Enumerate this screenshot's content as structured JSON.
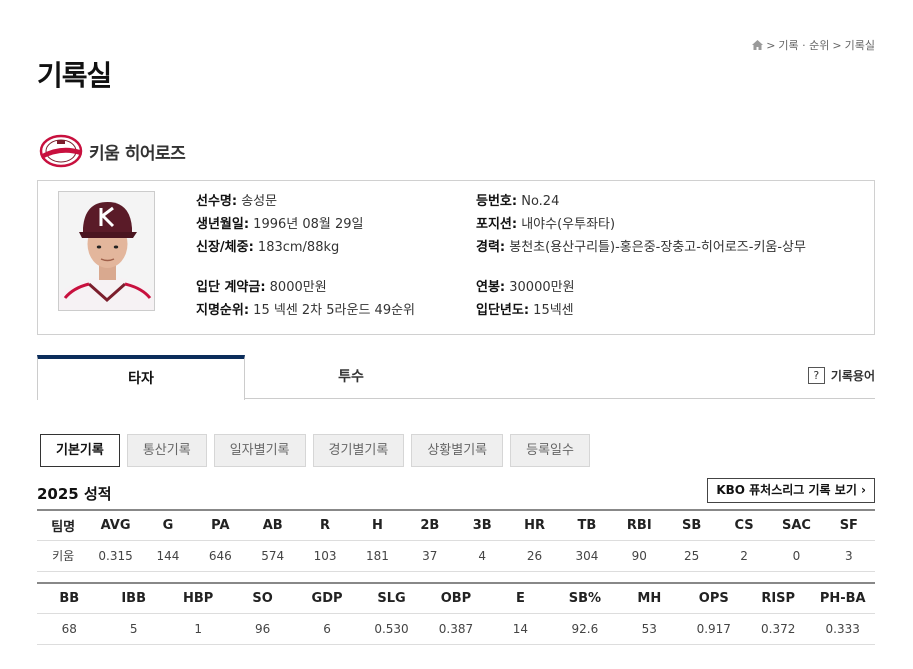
{
  "breadcrumb": {
    "icon": "home-icon",
    "items": [
      "기록 · 순위",
      "기록실"
    ],
    "separator": ">"
  },
  "page_title": "기록실",
  "team": {
    "name": "키움 히어로즈",
    "logo_icon": "kiwoom-heroes-logo",
    "colors": {
      "primary": "#c8103e",
      "secondary": "#7b1e2c"
    }
  },
  "player": {
    "photo_icon": "player-photo",
    "fields": [
      {
        "label": "선수명:",
        "value": " 송성문"
      },
      {
        "label": "생년월일:",
        "value": " 1996년 08월 29일"
      },
      {
        "label": "신장/체중:",
        "value": " 183cm/88kg"
      },
      {
        "label": "입단 계약금:",
        "value": " 8000만원"
      },
      {
        "label": "지명순위:",
        "value": " 15 넥센 2차 5라운드 49순위"
      },
      {
        "label": "등번호:",
        "value": " No.24"
      },
      {
        "label": "포지션:",
        "value": " 내야수(우투좌타)"
      },
      {
        "label": "경력:",
        "value": " 봉천초(용산구리틀)-홍은중-장충고-히어로즈-키움-상무"
      },
      {
        "label": "연봉:",
        "value": " 30000만원"
      },
      {
        "label": "입단년도:",
        "value": " 15넥센"
      }
    ]
  },
  "tabs": [
    {
      "label": "타자",
      "active": true
    },
    {
      "label": "투수",
      "active": false
    }
  ],
  "glossary": {
    "icon": "question-icon",
    "icon_text": "?",
    "label": "기록용어"
  },
  "subtabs": [
    {
      "label": "기본기록",
      "active": true
    },
    {
      "label": "통산기록",
      "active": false
    },
    {
      "label": "일자별기록",
      "active": false
    },
    {
      "label": "경기별기록",
      "active": false
    },
    {
      "label": "상황별기록",
      "active": false
    },
    {
      "label": "등록일수",
      "active": false
    }
  ],
  "season_title": "2025 성적",
  "kbo_button": {
    "label": "KBO 퓨처스리그 기록 보기",
    "icon": "chevron-right-icon",
    "icon_text": "›"
  },
  "table1": {
    "headers": [
      "팀명",
      "AVG",
      "G",
      "PA",
      "AB",
      "R",
      "H",
      "2B",
      "3B",
      "HR",
      "TB",
      "RBI",
      "SB",
      "CS",
      "SAC",
      "SF"
    ],
    "row": [
      "키움",
      "0.315",
      "144",
      "646",
      "574",
      "103",
      "181",
      "37",
      "4",
      "26",
      "304",
      "90",
      "25",
      "2",
      "0",
      "3"
    ]
  },
  "table2": {
    "headers": [
      "BB",
      "IBB",
      "HBP",
      "SO",
      "GDP",
      "SLG",
      "OBP",
      "E",
      "SB%",
      "MH",
      "OPS",
      "RISP",
      "PH-BA"
    ],
    "row": [
      "68",
      "5",
      "1",
      "96",
      "6",
      "0.530",
      "0.387",
      "14",
      "92.6",
      "53",
      "0.917",
      "0.372",
      "0.333"
    ]
  }
}
